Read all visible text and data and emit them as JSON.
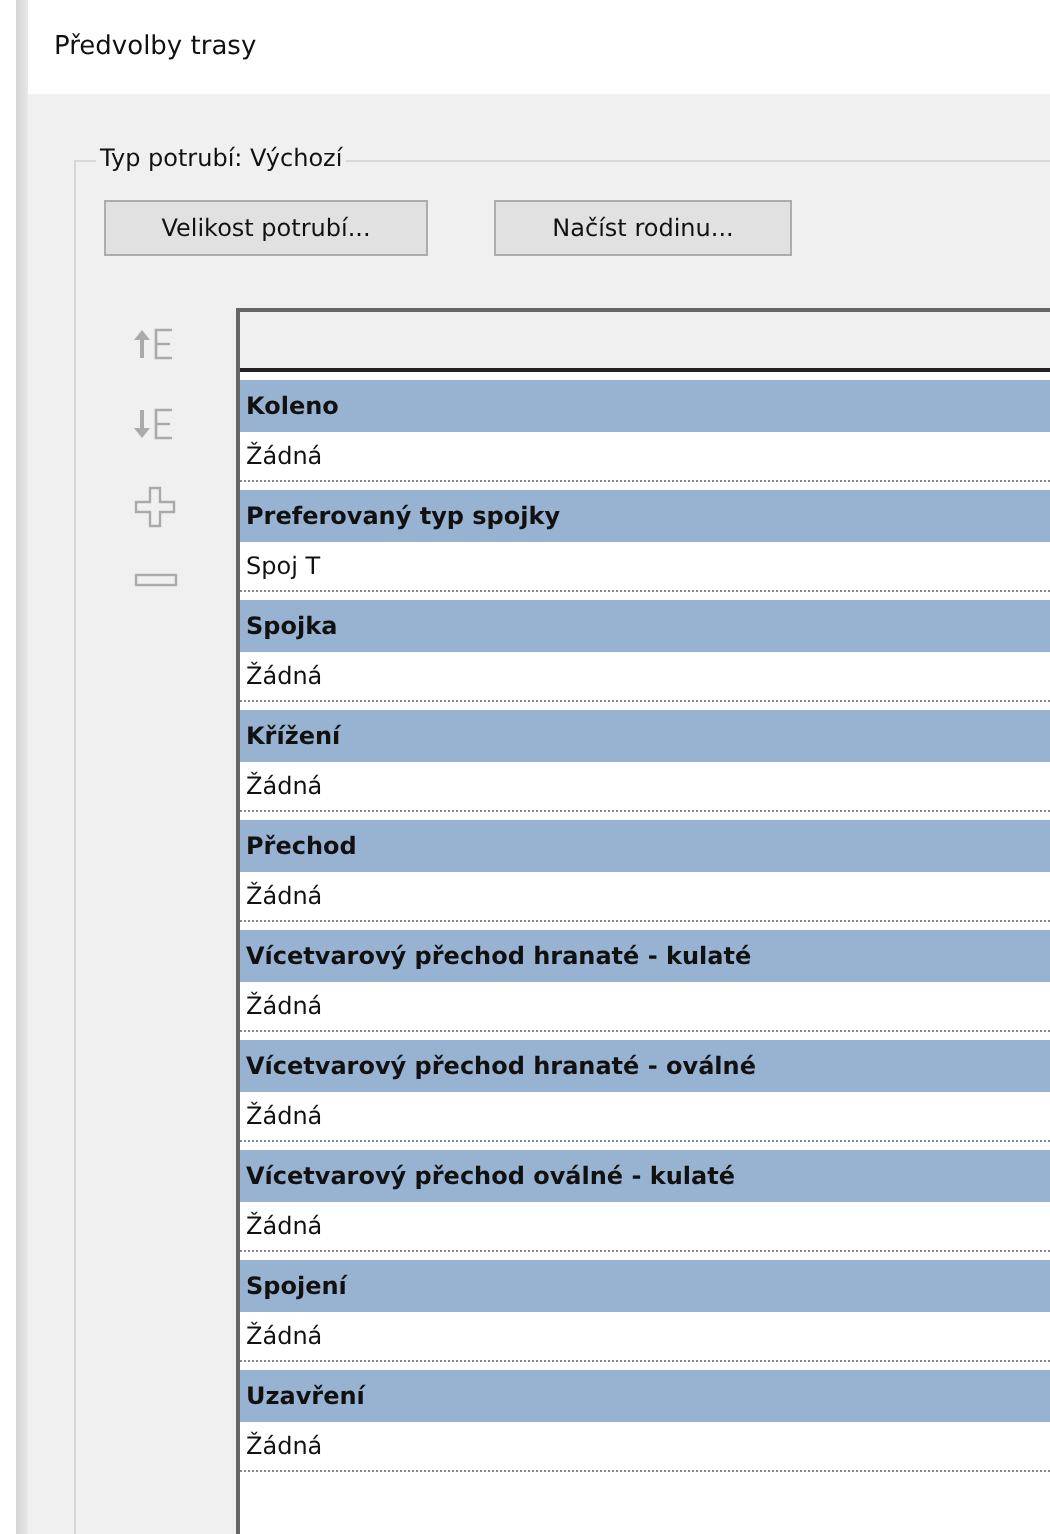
{
  "window": {
    "title": "Předvolby trasy"
  },
  "group": {
    "legend": "Typ potrubí: Výchozí"
  },
  "buttons": [
    "Velikost potrubí...",
    "Načíst rodinu..."
  ],
  "sections": [
    {
      "heading": "Koleno",
      "value": "Žádná"
    },
    {
      "heading": "Preferovaný typ spojky",
      "value": "Spoj T"
    },
    {
      "heading": "Spojka",
      "value": "Žádná"
    },
    {
      "heading": "Křížení",
      "value": "Žádná"
    },
    {
      "heading": "Přechod",
      "value": "Žádná"
    },
    {
      "heading": "Vícetvarový přechod hranaté - kulaté",
      "value": "Žádná"
    },
    {
      "heading": "Vícetvarový přechod hranaté - oválné",
      "value": "Žádná"
    },
    {
      "heading": "Vícetvarový přechod oválné - kulaté",
      "value": "Žádná"
    },
    {
      "heading": "Spojení",
      "value": "Žádná"
    },
    {
      "heading": "Uzavření",
      "value": "Žádná"
    }
  ]
}
